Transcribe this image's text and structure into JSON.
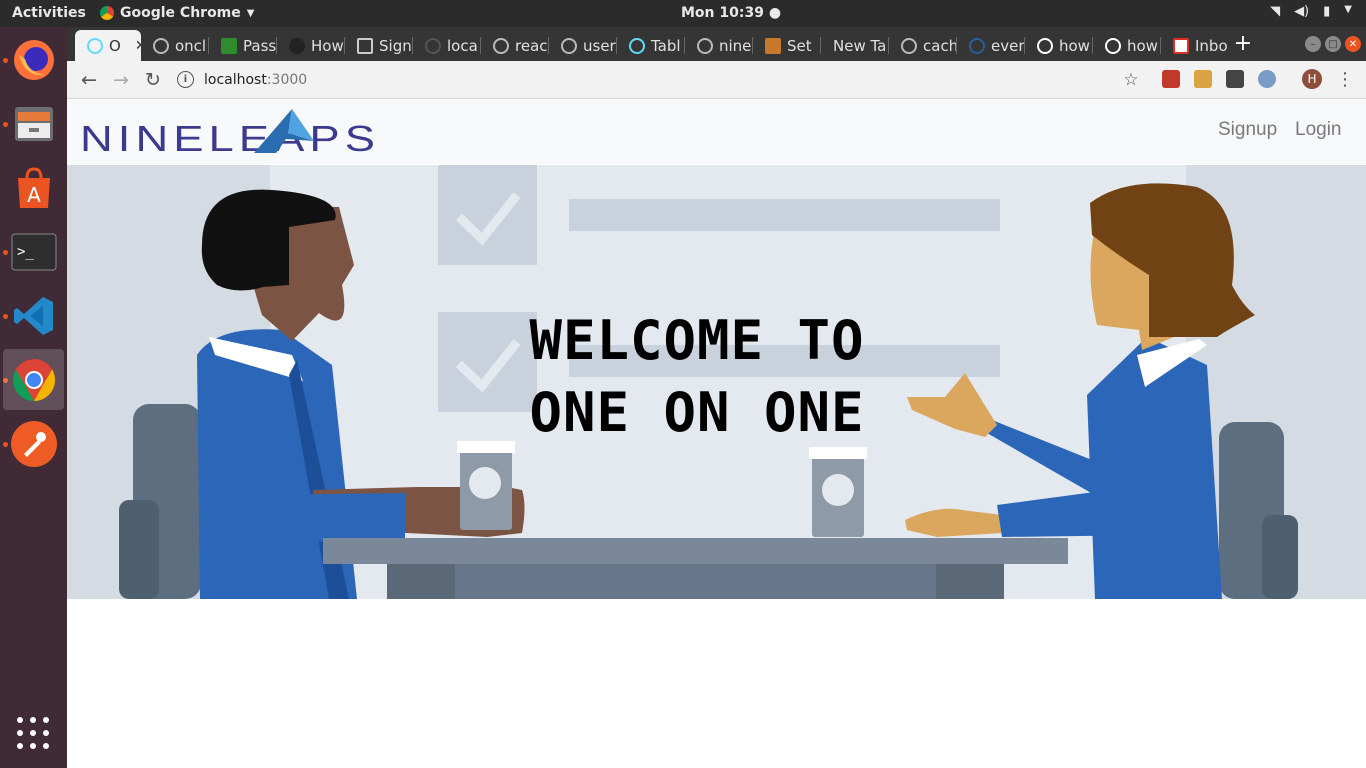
{
  "topbar": {
    "activities": "Activities",
    "app_name": "Google Chrome",
    "clock": "Mon 10:39"
  },
  "dock": {
    "items": [
      "firefox-icon",
      "files-icon",
      "software-center-icon",
      "terminal-icon",
      "vscode-icon",
      "chrome-icon",
      "postman-icon"
    ],
    "show_apps": "grid-icon"
  },
  "tabs": [
    {
      "label": "O",
      "icon": "react-icon",
      "active": true
    },
    {
      "label": "oncl",
      "icon": "google-icon"
    },
    {
      "label": "Pass",
      "icon": "green-icon"
    },
    {
      "label": "How",
      "icon": "github-icon"
    },
    {
      "label": "Sign",
      "icon": "codesandbox-icon"
    },
    {
      "label": "loca",
      "icon": "globe-icon"
    },
    {
      "label": "reac",
      "icon": "google-icon"
    },
    {
      "label": "user",
      "icon": "google-icon"
    },
    {
      "label": "Tabl",
      "icon": "react-icon"
    },
    {
      "label": "nine",
      "icon": "google-icon"
    },
    {
      "label": "Set",
      "icon": "stackoverflow-icon"
    },
    {
      "label": "New Ta",
      "icon": ""
    },
    {
      "label": "cach",
      "icon": "google-icon"
    },
    {
      "label": "ever",
      "icon": "edge-icon"
    },
    {
      "label": "how",
      "icon": "google-icon"
    },
    {
      "label": "how",
      "icon": "google-icon"
    },
    {
      "label": "Inbo",
      "icon": "gmail-icon"
    }
  ],
  "toolbar": {
    "url_host": "localhost",
    "url_port": ":3000",
    "avatar_letter": "H"
  },
  "page": {
    "logo_text": "NINELEAPS",
    "nav": {
      "signup": "Signup",
      "login": "Login"
    },
    "hero": {
      "line1": "WELCOME TO",
      "line2": "ONE ON ONE"
    }
  }
}
